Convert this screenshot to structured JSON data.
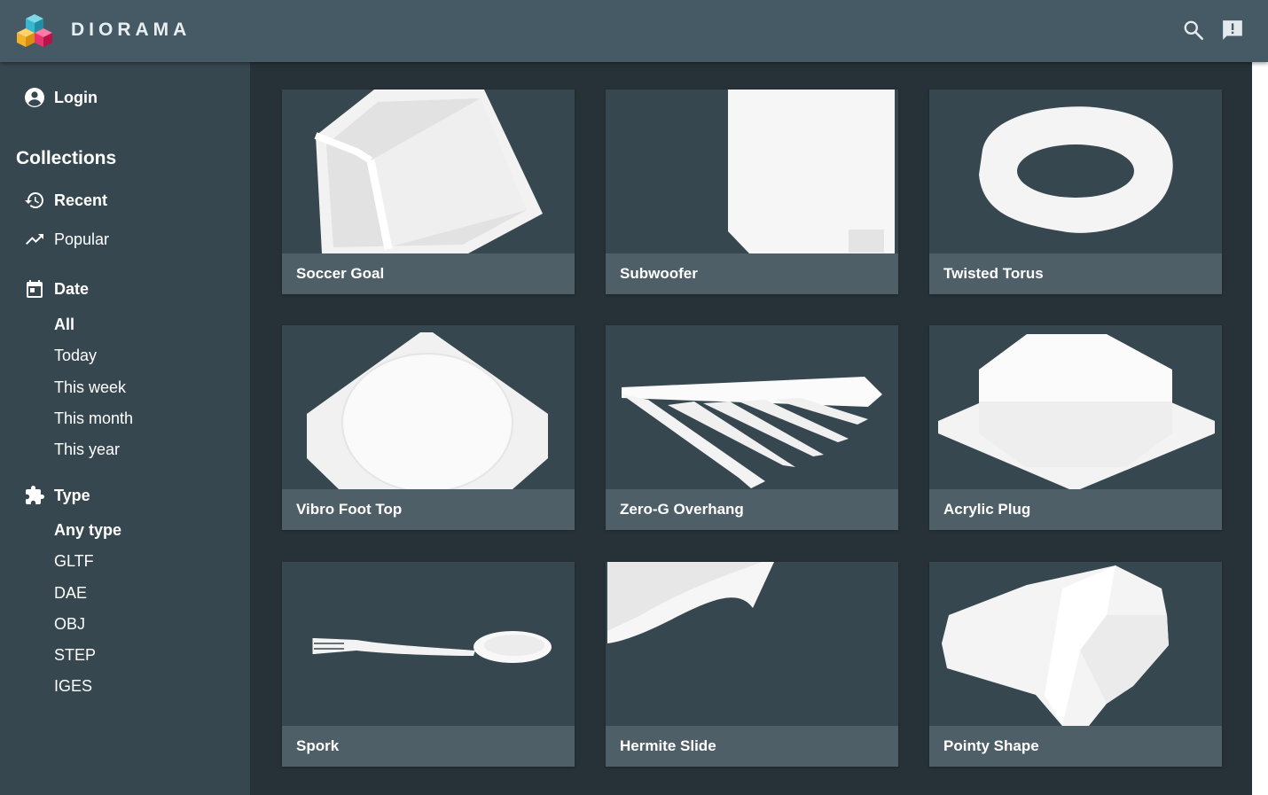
{
  "header": {
    "brand": "DIORAMA",
    "icons": {
      "logo": "diorama-cubes-logo",
      "search": "search-icon",
      "feedback": "feedback-icon"
    }
  },
  "sidebar": {
    "login_label": "Login",
    "collections_title": "Collections",
    "collections": [
      {
        "label": "Recent",
        "icon": "history-icon",
        "active": true
      },
      {
        "label": "Popular",
        "icon": "trending-up-icon",
        "active": false
      }
    ],
    "date_filter": {
      "label": "Date",
      "icon": "calendar-icon",
      "options": [
        "All",
        "Today",
        "This week",
        "This month",
        "This year"
      ],
      "selected": "All"
    },
    "type_filter": {
      "label": "Type",
      "icon": "puzzle-icon",
      "options": [
        "Any type",
        "GLTF",
        "DAE",
        "OBJ",
        "STEP",
        "IGES"
      ],
      "selected": "Any type"
    }
  },
  "models": [
    {
      "name": "Soccer Goal"
    },
    {
      "name": "Subwoofer"
    },
    {
      "name": "Twisted Torus"
    },
    {
      "name": "Vibro Foot Top"
    },
    {
      "name": "Zero-G Overhang"
    },
    {
      "name": "Acrylic Plug"
    },
    {
      "name": "Spork"
    },
    {
      "name": "Hermite Slide"
    },
    {
      "name": "Pointy Shape"
    }
  ],
  "colors": {
    "header": "#455a64",
    "sidebar": "#37474f",
    "main": "#263238",
    "card": "#37474f",
    "caption": "#4f5f67"
  }
}
